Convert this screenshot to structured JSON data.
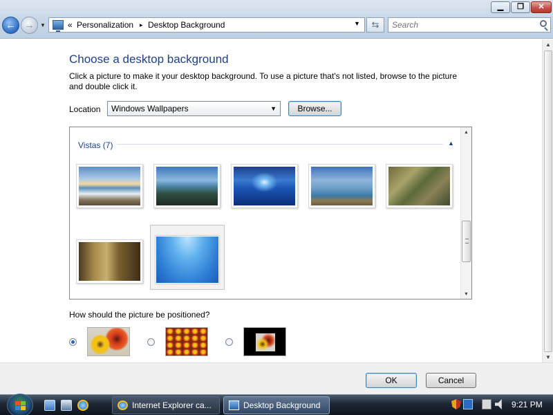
{
  "window": {
    "minimize_glyph": "▁",
    "maximize_glyph": "❐",
    "close_glyph": "✕"
  },
  "nav": {
    "back_glyph": "←",
    "forward_glyph": "→",
    "history_glyph": "▼",
    "breadcrumb_prefix": "«",
    "breadcrumb": [
      "Personalization",
      "Desktop Background"
    ],
    "breadcrumb_separator": "▸",
    "address_dropdown_glyph": "▼",
    "refresh_glyph": "⇆",
    "search_placeholder": "Search"
  },
  "page": {
    "title": "Choose a desktop background",
    "instructions": "Click a picture to make it your desktop background. To use a picture that's not listed, browse to the picture and double click it.",
    "location_label": "Location",
    "location_value": "Windows Wallpapers",
    "location_dropdown_glyph": "▼",
    "browse_label": "Browse...",
    "group": {
      "label": "Vistas (7)",
      "collapse_glyph": "▲"
    },
    "wallpapers": [
      {
        "name": "beach-waves",
        "selected": false
      },
      {
        "name": "rocky-coast",
        "selected": false
      },
      {
        "name": "underwater-sun",
        "selected": false
      },
      {
        "name": "ocean-horizon",
        "selected": false
      },
      {
        "name": "autumn-forest",
        "selected": false
      },
      {
        "name": "woodland-path",
        "selected": false
      },
      {
        "name": "blue-underwater",
        "selected": true
      }
    ],
    "position_question": "How should the picture be positioned?",
    "position_options": [
      {
        "name": "fit-to-screen",
        "selected": true
      },
      {
        "name": "tile",
        "selected": false
      },
      {
        "name": "center",
        "selected": false
      }
    ]
  },
  "footer": {
    "ok_label": "OK",
    "cancel_label": "Cancel"
  },
  "taskbar": {
    "tasks": [
      {
        "label": "Internet Explorer ca...",
        "active": false
      },
      {
        "label": "Desktop Background",
        "active": true
      }
    ],
    "clock": "9:21 PM"
  },
  "colors": {
    "accent": "#1e3f86",
    "title_text": "#1e3f86"
  }
}
